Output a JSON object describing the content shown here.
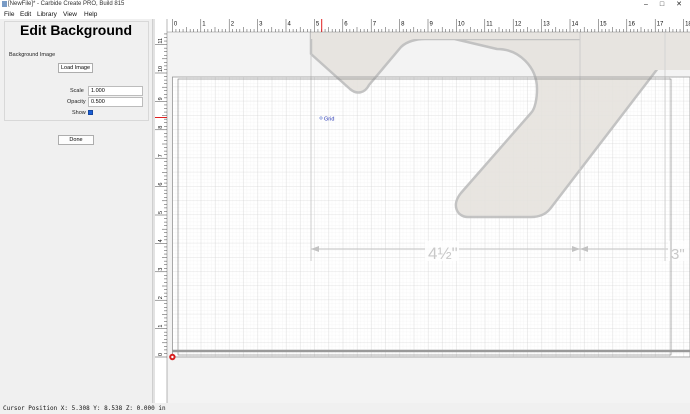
{
  "window": {
    "title": "[NewFile]* - Carbide Create PRO, Build 815",
    "minimize": "–",
    "maximize": "□",
    "close": "✕"
  },
  "menu": {
    "items": [
      "File",
      "Edit",
      "Library",
      "View",
      "Help"
    ]
  },
  "panel": {
    "title": "Edit Background",
    "section_label": "Background Image",
    "load_button": "Load Image",
    "scale_label": "Scale",
    "scale_value": "1.000",
    "opacity_label": "Opacity",
    "opacity_value": "0.500",
    "show_label": "Show",
    "show_checked": true,
    "done_button": "Done"
  },
  "canvas": {
    "grid_label": "Grid",
    "x_ticks": [
      "0",
      "1",
      "2",
      "3",
      "4",
      "5",
      "6",
      "7",
      "8",
      "9",
      "10",
      "11",
      "12",
      "13",
      "14",
      "15",
      "16",
      "17",
      "18"
    ],
    "y_ticks": [
      "0",
      "1",
      "2",
      "3",
      "4",
      "5",
      "6",
      "7",
      "8",
      "9",
      "10",
      "11"
    ],
    "dimension_label_1": "4½\"",
    "dimension_label_2": "3\"",
    "accent_color": "#e02020"
  },
  "status": {
    "text": "Cursor Position X: 5.308 Y: 8.538 Z: 0.000 in"
  }
}
